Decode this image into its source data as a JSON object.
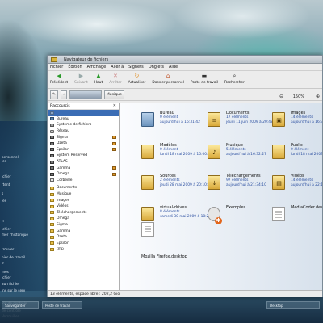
{
  "desktop": {
    "startmenu_items": [
      "personnel",
      "ier",
      "",
      "ichier",
      "rtent",
      "s",
      "les",
      "",
      "",
      "n",
      "ichier",
      "mer l'historique",
      "",
      "trouver",
      "nier de travail",
      "e",
      "mes",
      "ichier",
      "aun fichier",
      "ins sur le serv",
      "",
      "ion de contrôle",
      "de contrôle",
      "Verrouiller"
    ],
    "taskbar": {
      "buttons": [
        "Sauvegarder",
        "Poste de travail",
        "",
        "Desktop"
      ]
    }
  },
  "window": {
    "title": "Navigateur de fichiers",
    "menu": [
      "Fichier",
      "Édition",
      "Affichage",
      "Aller à",
      "Signets",
      "Onglets",
      "Aide"
    ],
    "toolbar": {
      "precedent": "Précédent",
      "suivant": "Suivant",
      "haut": "Haut",
      "arreter": "Arrêter",
      "actualiser": "Actualiser",
      "dossier_personnel": "Dossier personnel",
      "poste_de_travail": "Poste de travail",
      "rechercher": "Rechercher"
    },
    "location": {
      "home_crumb": "",
      "current": "Musique",
      "zoom": "150%"
    },
    "sidebar": {
      "header": "Raccourcis",
      "items": [
        {
          "label": "",
          "icon": "home-icon",
          "selected": true,
          "eject": false
        },
        {
          "label": "Bureau",
          "icon": "desktop-icon",
          "selected": false,
          "eject": false
        },
        {
          "label": "Système de fichiers",
          "icon": "filesystem-icon",
          "selected": false,
          "eject": false
        },
        {
          "label": "Réseau",
          "icon": "network-icon",
          "selected": false,
          "eject": false
        },
        {
          "label": "Sigma",
          "icon": "drive-icon",
          "selected": false,
          "eject": true
        },
        {
          "label": "Dzeta",
          "icon": "drive-icon",
          "selected": false,
          "eject": true
        },
        {
          "label": "Epsilon",
          "icon": "drive-icon",
          "selected": false,
          "eject": true
        },
        {
          "label": "System Reserved",
          "icon": "drive-icon",
          "selected": false,
          "eject": false
        },
        {
          "label": "ATLAS",
          "icon": "drive-icon",
          "selected": false,
          "eject": false
        },
        {
          "label": "Gamma",
          "icon": "drive-icon",
          "selected": false,
          "eject": true
        },
        {
          "label": "Omega",
          "icon": "drive-icon",
          "selected": false,
          "eject": true
        },
        {
          "label": "Corbeille",
          "icon": "trash-icon",
          "selected": false,
          "eject": false
        },
        {
          "label": "Documents",
          "icon": "folder-icon",
          "selected": false,
          "eject": false
        },
        {
          "label": "Musique",
          "icon": "folder-icon",
          "selected": false,
          "eject": false
        },
        {
          "label": "Images",
          "icon": "folder-icon",
          "selected": false,
          "eject": false
        },
        {
          "label": "Vidéos",
          "icon": "folder-icon",
          "selected": false,
          "eject": false
        },
        {
          "label": "Téléchargements",
          "icon": "folder-icon",
          "selected": false,
          "eject": false
        },
        {
          "label": "Omega",
          "icon": "folder-icon",
          "selected": false,
          "eject": false
        },
        {
          "label": "Sigma",
          "icon": "folder-icon",
          "selected": false,
          "eject": false
        },
        {
          "label": "Gamma",
          "icon": "folder-icon",
          "selected": false,
          "eject": false
        },
        {
          "label": "Dzeta",
          "icon": "folder-icon",
          "selected": false,
          "eject": false
        },
        {
          "label": "Epsilon",
          "icon": "folder-icon",
          "selected": false,
          "eject": false
        },
        {
          "label": "tmp",
          "icon": "folder-icon",
          "selected": false,
          "eject": false
        }
      ]
    },
    "files": [
      {
        "name": "Bureau",
        "count": "0 élément",
        "date": "aujourd'hui à 16:31:42",
        "kind": "folder-blue",
        "emblem": ""
      },
      {
        "name": "Documents",
        "count": "17 éléments",
        "date": "jeudi 11 juin 2009 à 20:42:26",
        "kind": "folder",
        "emblem": "≡"
      },
      {
        "name": "Images",
        "count": "14 éléments",
        "date": "aujourd'hui à 16:38",
        "kind": "folder",
        "emblem": "▣"
      },
      {
        "name": "Modèles",
        "count": "0 élément",
        "date": "lundi 18 mai 2009 à 15:00:49",
        "kind": "folder",
        "emblem": ""
      },
      {
        "name": "Musique",
        "count": "5 éléments",
        "date": "aujourd'hui à 16:32:27",
        "kind": "folder",
        "emblem": "♪"
      },
      {
        "name": "Public",
        "count": "0 élément",
        "date": "lundi 18 mai 2009",
        "kind": "folder",
        "emblem": ""
      },
      {
        "name": "Sources",
        "count": "2 éléments",
        "date": "jeudi 28 mai 2009 à 20:10:58",
        "kind": "folder",
        "emblem": ""
      },
      {
        "name": "Téléchargements",
        "count": "97 éléments",
        "date": "aujourd'hui à 21:34:10",
        "kind": "folder",
        "emblem": "↓"
      },
      {
        "name": "Vidéos",
        "count": "14 éléments",
        "date": "aujourd'hui à 22:11",
        "kind": "folder",
        "emblem": "▤"
      },
      {
        "name": "virtual-drives",
        "count": "8 éléments",
        "date": "samedi 30 mai 2009 à 18:26:01",
        "kind": "folder",
        "emblem": ""
      },
      {
        "name": "Exemples",
        "count": "",
        "date": "",
        "kind": "circle",
        "emblem": ""
      },
      {
        "name": "MediaCoder.deskto",
        "count": "",
        "date": "",
        "kind": "doc",
        "emblem": ""
      },
      {
        "name": "Mozilla Firefox.desktop",
        "count": "",
        "date": "",
        "kind": "doc",
        "emblem": ""
      }
    ],
    "status": "13 éléments, espace libre : 202,2 Gio"
  }
}
